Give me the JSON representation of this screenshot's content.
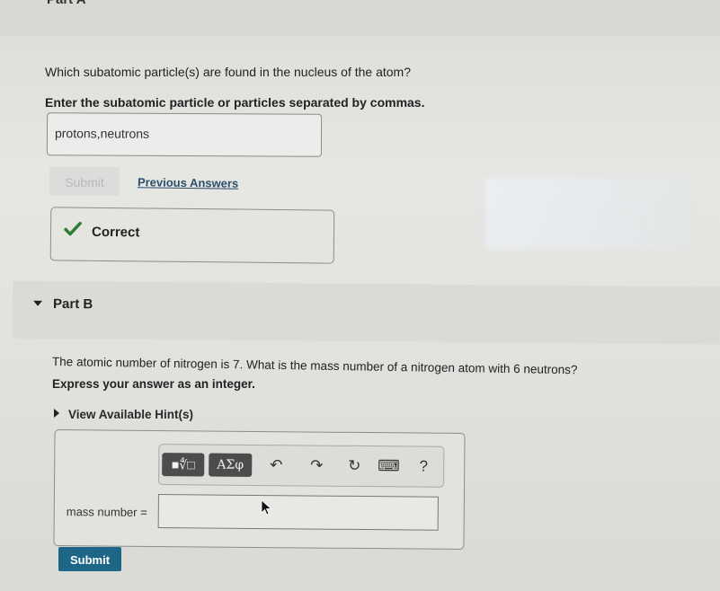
{
  "part_a": {
    "title": "Part A",
    "question": "Which subatomic particle(s) are found in the nucleus of the atom?",
    "instruction": "Enter the subatomic particle or particles separated by commas.",
    "answer_value": "protons,neutrons",
    "submit_label": "Submit",
    "previous_answers_label": "Previous Answers",
    "feedback_label": "Correct",
    "feedback_color": "#2e7d32"
  },
  "part_b": {
    "title": "Part B",
    "question": "The atomic number of nitrogen is 7. What is the mass number of a nitrogen atom with 6 neutrons?",
    "instruction": "Express your answer as an integer.",
    "hint_label": "View Available Hint(s)",
    "toolbar": {
      "templates_label": "■∜□",
      "greek_label": "ΑΣφ",
      "undo_icon": "↶",
      "redo_icon": "↷",
      "reset_icon": "↻",
      "keyboard_icon": "⌨",
      "help_label": "?"
    },
    "input_label": "mass number =",
    "input_value": "",
    "submit_label": "Submit",
    "submit_color": "#1e6687"
  }
}
